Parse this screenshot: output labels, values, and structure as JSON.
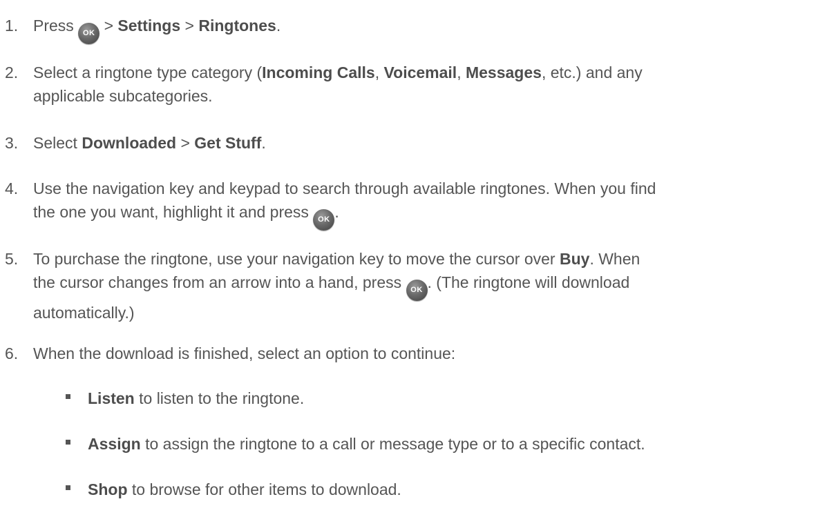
{
  "steps": [
    {
      "num": "1.",
      "parts": [
        "Press ",
        "ok",
        " > ",
        "Settings",
        " > ",
        "Ringtones",
        "."
      ]
    },
    {
      "num": "2.",
      "t1": "Select a ringtone type category (",
      "b1": "Incoming Calls",
      "t2": ", ",
      "b2": "Voicemail",
      "t3": ", ",
      "b3": "Messages",
      "t4": ", etc.) and any",
      "line2": "applicable subcategories."
    },
    {
      "num": "3.",
      "t1": "Select ",
      "b1": "Downloaded",
      "t2": " > ",
      "b2": "Get Stuff",
      "t3": "."
    },
    {
      "num": "4.",
      "line1": "Use the navigation key and keypad to search through available ringtones. When you find",
      "line2": "the one you want, highlight it and press ",
      "end": "."
    },
    {
      "num": "5.",
      "t1": "To purchase the ringtone, use your navigation key to move the cursor over ",
      "b1": "Buy",
      "t2": ". When",
      "line2a": "the cursor changes from an arrow into a hand, press ",
      "line2b": ". (The ringtone will download",
      "line3": "automatically.)"
    },
    {
      "num": "6.",
      "line1": "When the download is finished, select an option to continue:"
    }
  ],
  "options": [
    {
      "label": "Listen",
      "desc": " to listen to the ringtone."
    },
    {
      "label": "Assign",
      "desc": " to assign the ringtone to a call or message type or to a specific contact."
    },
    {
      "label": "Shop",
      "desc": " to browse for other items to download."
    }
  ],
  "ok_key": {
    "label": "OK",
    "icon": "ok-key-icon"
  }
}
